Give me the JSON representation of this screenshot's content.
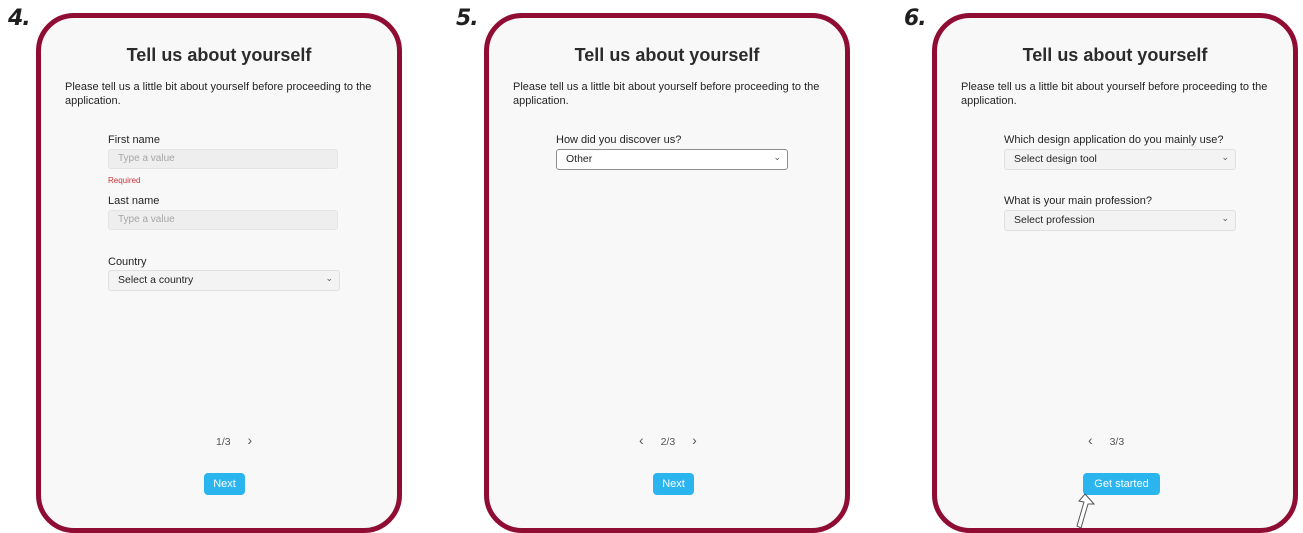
{
  "panels": [
    {
      "step": "4.",
      "title": "Tell us about yourself",
      "description": "Please tell us a little bit about yourself before proceeding to the application.",
      "first_name": {
        "label": "First name",
        "placeholder": "Type a value",
        "error": "Required"
      },
      "last_name": {
        "label": "Last name",
        "placeholder": "Type a value"
      },
      "country": {
        "label": "Country",
        "value": "Select a country"
      },
      "pager": {
        "page": "1/3",
        "next": "›"
      },
      "button": "Next"
    },
    {
      "step": "5.",
      "title": "Tell us about yourself",
      "description": "Please tell us a little bit about yourself before proceeding to the application.",
      "discover": {
        "label": "How did you discover us?",
        "value": "Other"
      },
      "pager": {
        "prev": "‹",
        "page": "2/3",
        "next": "›"
      },
      "button": "Next"
    },
    {
      "step": "6.",
      "title": "Tell us about yourself",
      "description": "Please tell us a little bit about yourself before proceeding to the application.",
      "design_tool": {
        "label": "Which design application do you mainly use?",
        "value": "Select design tool"
      },
      "profession": {
        "label": "What is your main profession?",
        "value": "Select profession"
      },
      "pager": {
        "prev": "‹",
        "page": "3/3"
      },
      "button": "Get started"
    }
  ],
  "icons": {
    "dropdown": "chevron-down-icon",
    "prev": "chevron-left-icon",
    "next": "chevron-right-icon",
    "pointer": "hand-pointer-icon"
  },
  "colors": {
    "frame": "#8f0d33",
    "button": "#2bb5ef",
    "error": "#d13438",
    "panel_bg": "#f8f8f8"
  }
}
